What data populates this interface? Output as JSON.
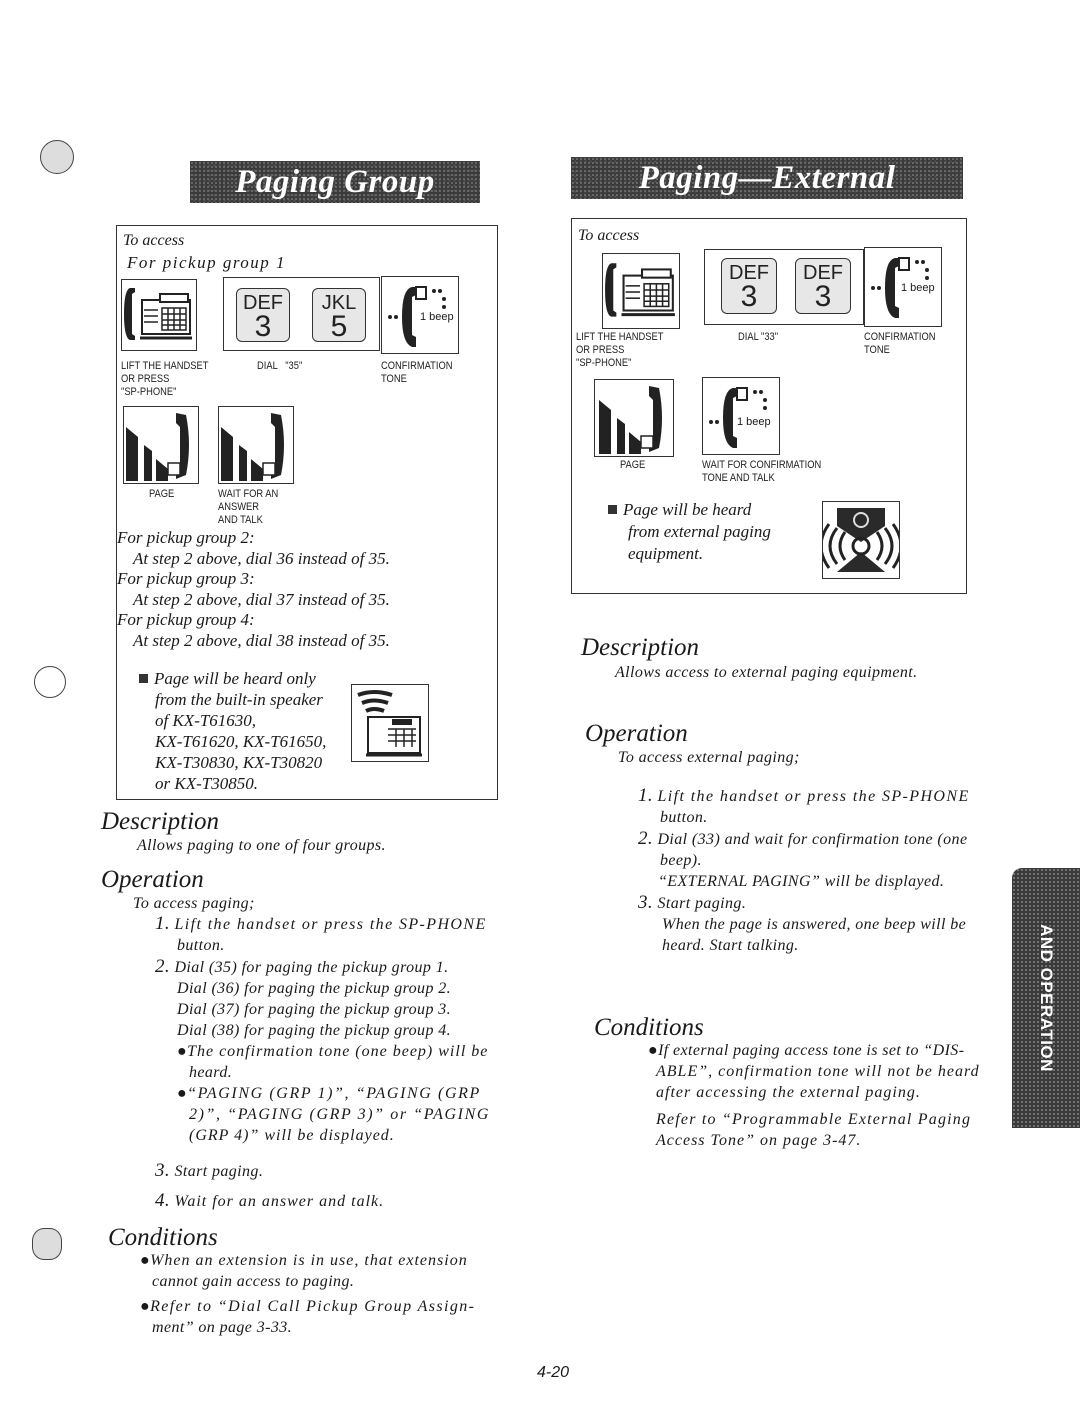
{
  "page_number": "4-20",
  "side_tab": "AND OPERATION",
  "left": {
    "title": "Paging Group",
    "access_box": {
      "heading": "To access",
      "subheading": "For pickup group 1",
      "steps": [
        {
          "icon": "telephone-icon",
          "label": "LIFT THE HANDSET\nOR PRESS\n\"SP-PHONE\""
        },
        {
          "icon": "dial-keys-icon",
          "keys": [
            {
              "letters": "DEF",
              "digit": "3"
            },
            {
              "letters": "JKL",
              "digit": "5"
            }
          ],
          "label": "DIAL   \"35\""
        },
        {
          "icon": "confirmation-tone-icon",
          "beep": "1 beep",
          "label": "CONFIRMATION\nTONE"
        },
        {
          "icon": "page-handset-icon",
          "label": "PAGE"
        },
        {
          "icon": "talk-handset-icon",
          "label": "WAIT FOR AN\nANSWER\nAND TALK"
        }
      ],
      "other_groups": [
        {
          "group": "For pickup group 2:",
          "instruction": "At step 2 above, dial 36 instead of 35."
        },
        {
          "group": "For pickup group 3:",
          "instruction": "At step 2 above, dial 37 instead of 35."
        },
        {
          "group": "For pickup group 4:",
          "instruction": "At step 2 above, dial 38 instead of 35."
        }
      ],
      "note_lines": [
        "Page will be heard only",
        "from the built-in speaker",
        "of KX-T61630,",
        "KX-T61620, KX-T61650,",
        "KX-T30830, KX-T30820",
        "or KX-T30850."
      ]
    },
    "description": {
      "heading": "Description",
      "text": "Allows paging to one of four groups."
    },
    "operation": {
      "heading": "Operation",
      "intro": "To access paging;",
      "steps": [
        {
          "num": "1.",
          "lines": [
            "Lift the handset or press the SP-PHONE",
            "button."
          ]
        },
        {
          "num": "2.",
          "lines": [
            "Dial (35) for paging the pickup group 1.",
            "Dial (36) for paging the pickup group 2.",
            "Dial (37) for paging the pickup group 3.",
            "Dial (38) for paging the pickup group 4."
          ]
        },
        {
          "num": "3.",
          "lines": [
            "Start paging."
          ]
        },
        {
          "num": "4.",
          "lines": [
            "Wait for an answer and talk."
          ]
        }
      ],
      "bullets": [
        [
          "The confirmation tone (one beep) will be",
          "heard."
        ],
        [
          "“PAGING (GRP 1)”, “PAGING (GRP",
          "2)”, “PAGING (GRP 3)” or “PAGING",
          "(GRP 4)” will be displayed."
        ]
      ]
    },
    "conditions": {
      "heading": "Conditions",
      "items": [
        [
          "When an extension is in use, that extension",
          "cannot gain access to paging."
        ],
        [
          "Refer to “Dial Call Pickup Group Assign-",
          "ment” on page 3-33."
        ]
      ]
    }
  },
  "right": {
    "title": "Paging—External",
    "access_box": {
      "heading": "To access",
      "steps": [
        {
          "icon": "telephone-icon",
          "label": "LIFT THE HANDSET\nOR PRESS\n\"SP-PHONE\""
        },
        {
          "icon": "dial-keys-icon",
          "keys": [
            {
              "letters": "DEF",
              "digit": "3"
            },
            {
              "letters": "DEF",
              "digit": "3"
            }
          ],
          "label": "DIAL \"33\""
        },
        {
          "icon": "confirmation-tone-icon",
          "beep": "1 beep",
          "label": "CONFIRMATION\nTONE"
        },
        {
          "icon": "page-handset-icon",
          "label": "PAGE"
        },
        {
          "icon": "confirmation-tone-icon",
          "beep": "1 beep",
          "label": "WAIT FOR CONFIRMATION\nTONE AND TALK"
        }
      ],
      "note_lines": [
        "Page will be heard",
        "from external paging",
        "equipment."
      ]
    },
    "description": {
      "heading": "Description",
      "text": "Allows access to external paging equipment."
    },
    "operation": {
      "heading": "Operation",
      "intro": "To access external paging;",
      "steps": [
        {
          "num": "1.",
          "lines": [
            "Lift the handset or press the SP-PHONE",
            "button."
          ]
        },
        {
          "num": "2.",
          "lines": [
            "Dial (33) and wait for confirmation tone (one",
            "beep)."
          ]
        },
        {
          "num": "",
          "lines": [
            "“EXTERNAL PAGING” will be displayed."
          ]
        },
        {
          "num": "3.",
          "lines": [
            "Start paging.",
            "When the page is answered, one beep will be",
            "heard. Start talking."
          ]
        }
      ]
    },
    "conditions": {
      "heading": "Conditions",
      "items": [
        [
          "If external paging access tone is set to “DIS-",
          "ABLE”, confirmation tone will not be heard",
          "after accessing the external paging."
        ]
      ],
      "refer": [
        "Refer to “Programmable External Paging",
        "Access Tone” on page 3-47."
      ]
    }
  }
}
